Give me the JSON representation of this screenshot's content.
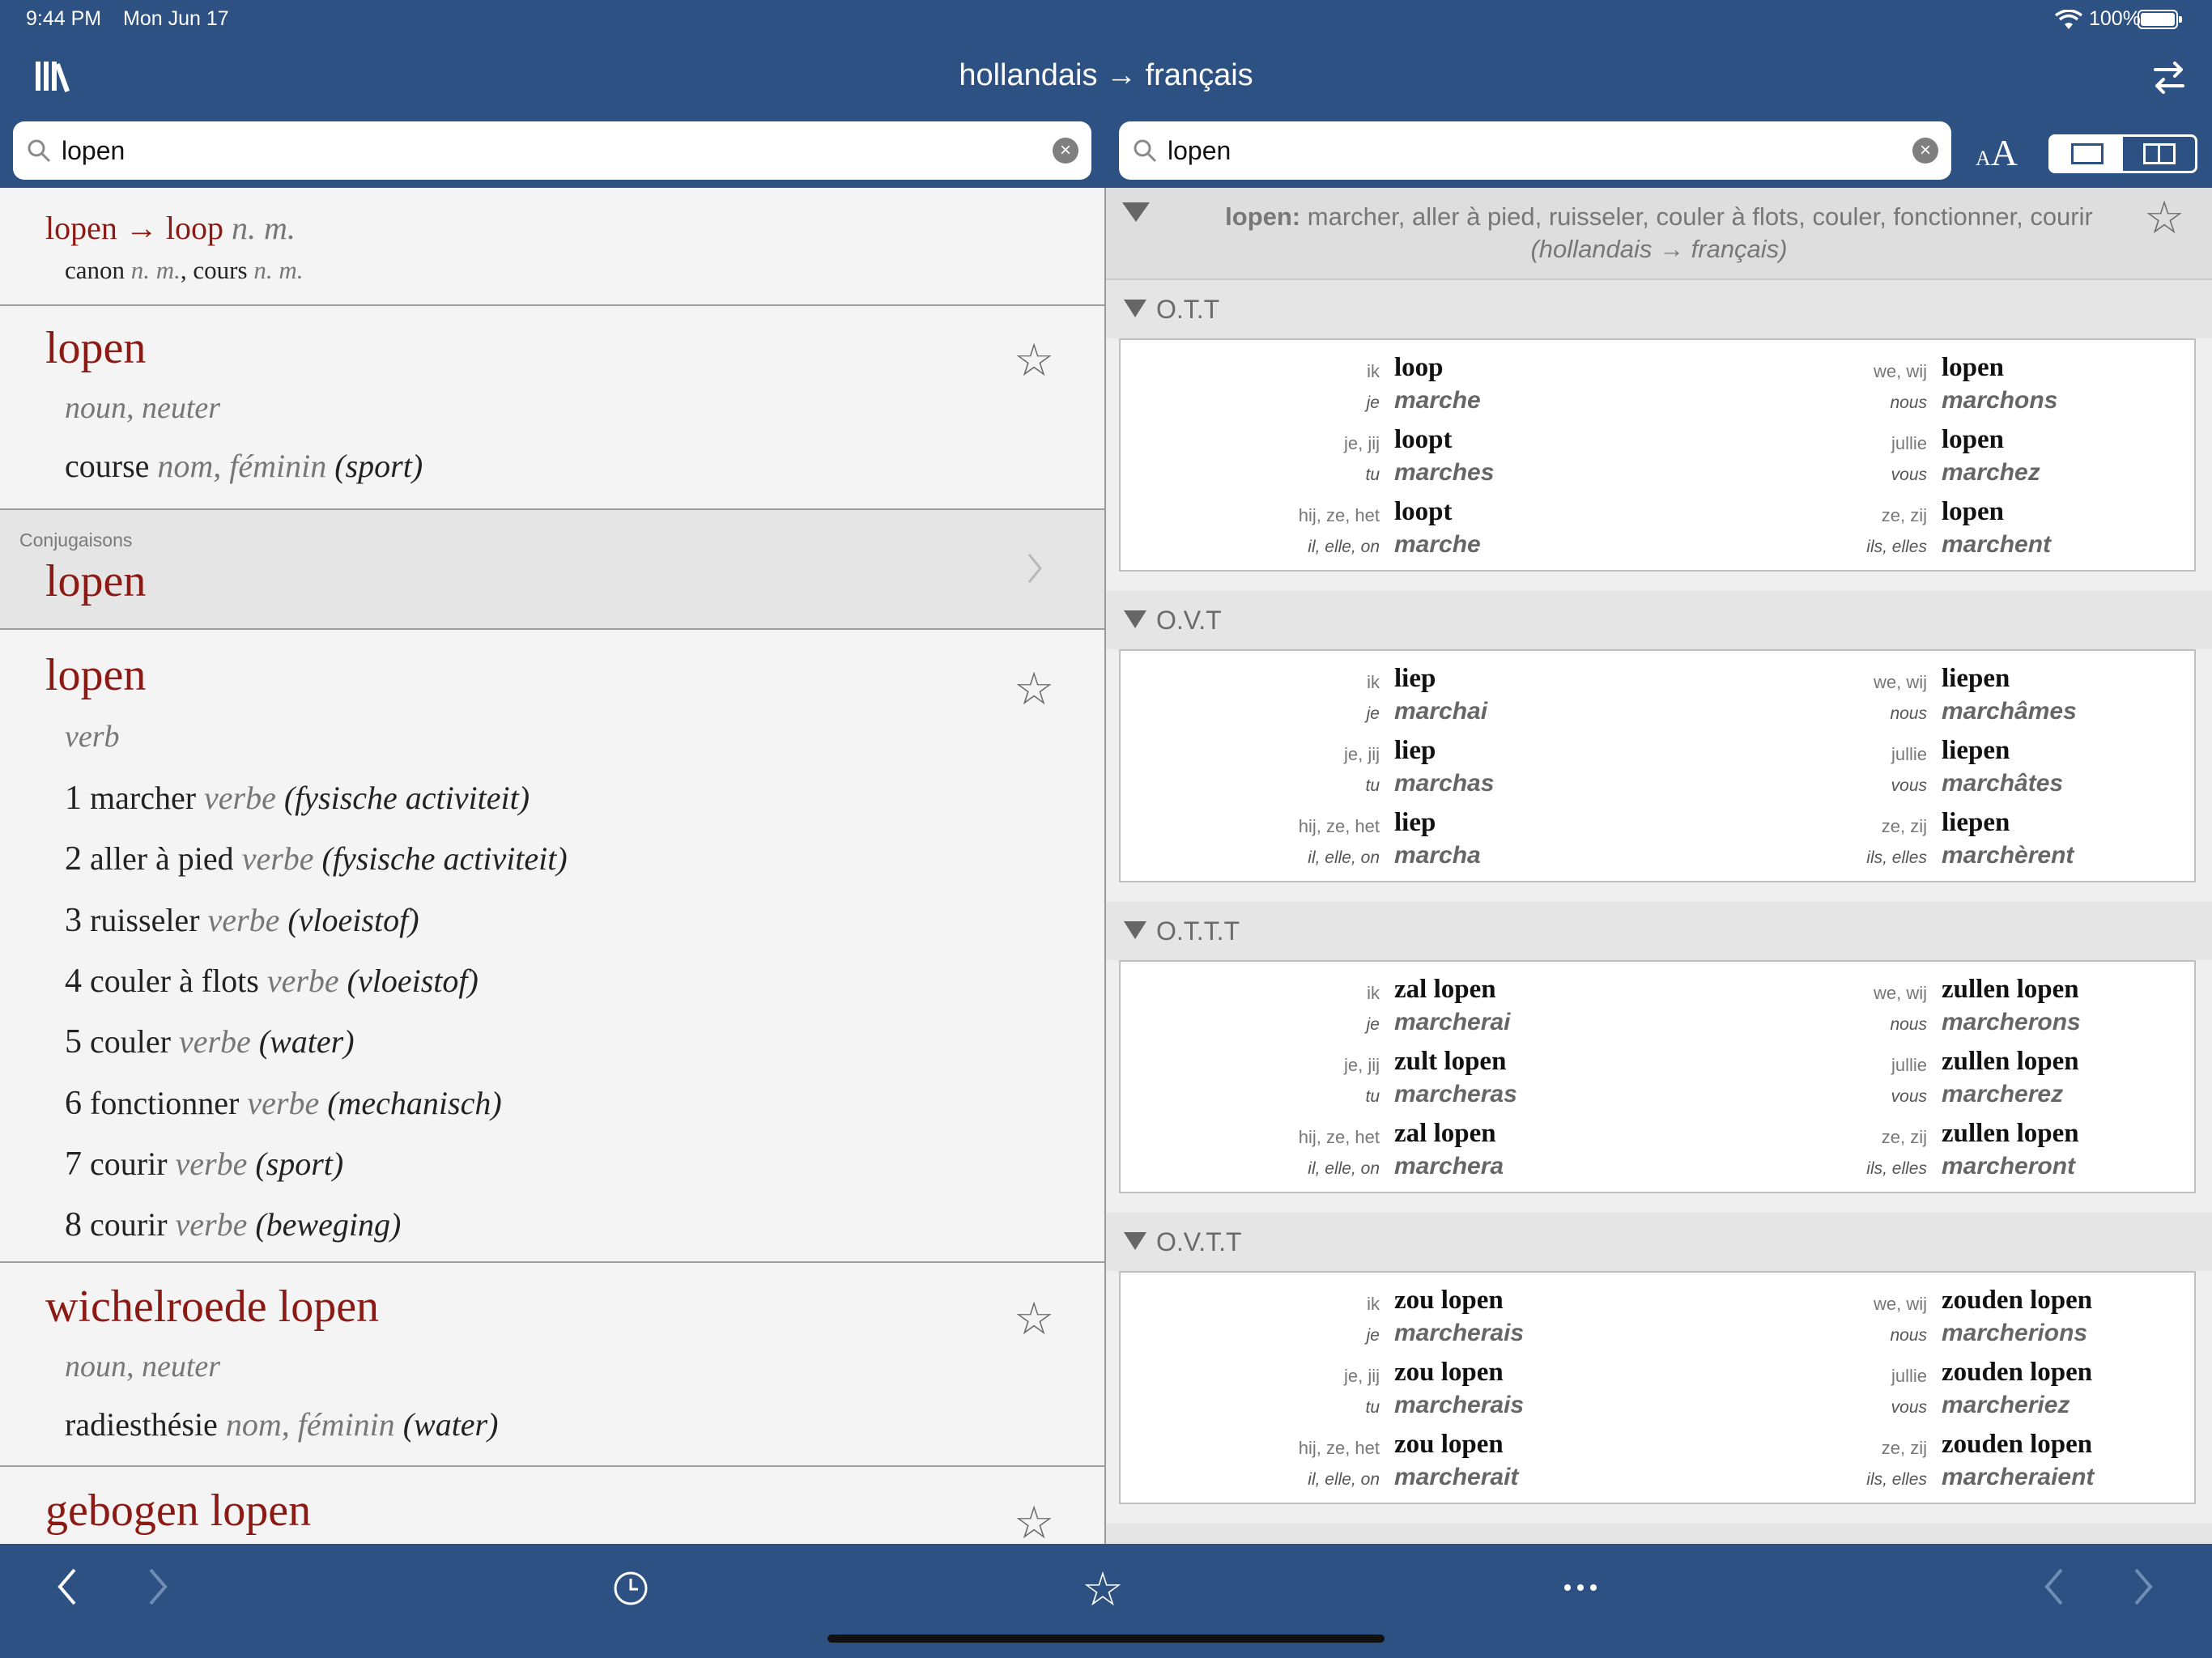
{
  "status": {
    "time": "9:44 PM",
    "date": "Mon Jun 17",
    "battery": "100%"
  },
  "nav": {
    "title": "hollandais → français"
  },
  "left_search": {
    "value": "lopen"
  },
  "right_search": {
    "value": "lopen"
  },
  "font_size": {
    "small": "A",
    "big": "A"
  },
  "left": {
    "redirect": {
      "from": "lopen",
      "arrow": "→",
      "to": "loop",
      "to_pos": "n. m.",
      "t1": "canon",
      "t1_pos": "n. m.",
      "sep": ",",
      "t2": "cours",
      "t2_pos": "n. m."
    },
    "entry1": {
      "word": "lopen",
      "pos": "noun, neuter",
      "trans": "course",
      "trans_pos": "nom, féminin",
      "domain": "(sport)"
    },
    "conj": {
      "header": "Conjugaisons",
      "word": "lopen"
    },
    "entry2": {
      "word": "lopen",
      "pos": "verb",
      "senses": [
        {
          "num": "1",
          "text": "marcher",
          "pos": "verbe",
          "domain": "(fysische activiteit)"
        },
        {
          "num": "2",
          "text": "aller à pied",
          "pos": "verbe",
          "domain": "(fysische activiteit)"
        },
        {
          "num": "3",
          "text": "ruisseler",
          "pos": "verbe",
          "domain": "(vloeistof)"
        },
        {
          "num": "4",
          "text": "couler à flots",
          "pos": "verbe",
          "domain": "(vloeistof)"
        },
        {
          "num": "5",
          "text": "couler",
          "pos": "verbe",
          "domain": "(water)"
        },
        {
          "num": "6",
          "text": "fonctionner",
          "pos": "verbe",
          "domain": "(mechanisch)"
        },
        {
          "num": "7",
          "text": "courir",
          "pos": "verbe",
          "domain": "(sport)"
        },
        {
          "num": "8",
          "text": "courir",
          "pos": "verbe",
          "domain": "(beweging)"
        }
      ]
    },
    "entry3": {
      "word": "wichelroede lopen",
      "pos": "noun, neuter",
      "trans": "radiesthésie",
      "trans_pos": "nom, féminin",
      "domain": "(water)"
    },
    "entry4": {
      "word": "gebogen lopen"
    }
  },
  "right": {
    "summary": {
      "word": "lopen:",
      "text": " marcher, aller à pied, ruisseler, couler à flots, couler, fonctionner, courir",
      "dir": "(hollandais → français)"
    },
    "tenses": [
      {
        "name": "O.T.T",
        "rows": [
          {
            "nl_pron": "ik",
            "nl": "loop",
            "fr_pron": "je",
            "fr": "marche",
            "nl_pron2": "we, wij",
            "nl2": "lopen",
            "fr_pron2": "nous",
            "fr2": "marchons"
          },
          {
            "nl_pron": "je, jij",
            "nl": "loopt",
            "fr_pron": "tu",
            "fr": "marches",
            "nl_pron2": "jullie",
            "nl2": "lopen",
            "fr_pron2": "vous",
            "fr2": "marchez"
          },
          {
            "nl_pron": "hij, ze, het",
            "nl": "loopt",
            "fr_pron": "il, elle, on",
            "fr": "marche",
            "nl_pron2": "ze, zij",
            "nl2": "lopen",
            "fr_pron2": "ils, elles",
            "fr2": "marchent"
          }
        ]
      },
      {
        "name": "O.V.T",
        "rows": [
          {
            "nl_pron": "ik",
            "nl": "liep",
            "fr_pron": "je",
            "fr": "marchai",
            "nl_pron2": "we, wij",
            "nl2": "liepen",
            "fr_pron2": "nous",
            "fr2": "marchâmes"
          },
          {
            "nl_pron": "je, jij",
            "nl": "liep",
            "fr_pron": "tu",
            "fr": "marchas",
            "nl_pron2": "jullie",
            "nl2": "liepen",
            "fr_pron2": "vous",
            "fr2": "marchâtes"
          },
          {
            "nl_pron": "hij, ze, het",
            "nl": "liep",
            "fr_pron": "il, elle, on",
            "fr": "marcha",
            "nl_pron2": "ze, zij",
            "nl2": "liepen",
            "fr_pron2": "ils, elles",
            "fr2": "marchèrent"
          }
        ]
      },
      {
        "name": "O.T.T.T",
        "rows": [
          {
            "nl_pron": "ik",
            "nl": "zal lopen",
            "fr_pron": "je",
            "fr": "marcherai",
            "nl_pron2": "we, wij",
            "nl2": "zullen lopen",
            "fr_pron2": "nous",
            "fr2": "marcherons"
          },
          {
            "nl_pron": "je, jij",
            "nl": "zult lopen",
            "fr_pron": "tu",
            "fr": "marcheras",
            "nl_pron2": "jullie",
            "nl2": "zullen lopen",
            "fr_pron2": "vous",
            "fr2": "marcherez"
          },
          {
            "nl_pron": "hij, ze, het",
            "nl": "zal lopen",
            "fr_pron": "il, elle, on",
            "fr": "marchera",
            "nl_pron2": "ze, zij",
            "nl2": "zullen lopen",
            "fr_pron2": "ils, elles",
            "fr2": "marcheront"
          }
        ]
      },
      {
        "name": "O.V.T.T",
        "rows": [
          {
            "nl_pron": "ik",
            "nl": "zou lopen",
            "fr_pron": "je",
            "fr": "marcherais",
            "nl_pron2": "we, wij",
            "nl2": "zouden lopen",
            "fr_pron2": "nous",
            "fr2": "marcherions"
          },
          {
            "nl_pron": "je, jij",
            "nl": "zou lopen",
            "fr_pron": "tu",
            "fr": "marcherais",
            "nl_pron2": "jullie",
            "nl2": "zouden lopen",
            "fr_pron2": "vous",
            "fr2": "marcheriez"
          },
          {
            "nl_pron": "hij, ze, het",
            "nl": "zou lopen",
            "fr_pron": "il, elle, on",
            "fr": "marcherait",
            "nl_pron2": "ze, zij",
            "nl2": "zouden lopen",
            "fr_pron2": "ils, elles",
            "fr2": "marcheraient"
          }
        ]
      }
    ]
  },
  "icons": [
    "library-icon",
    "swap-icon",
    "search-icon",
    "clear-icon",
    "star-icon",
    "chevron-right-icon",
    "history-icon",
    "more-icon",
    "back-icon",
    "forward-icon"
  ]
}
